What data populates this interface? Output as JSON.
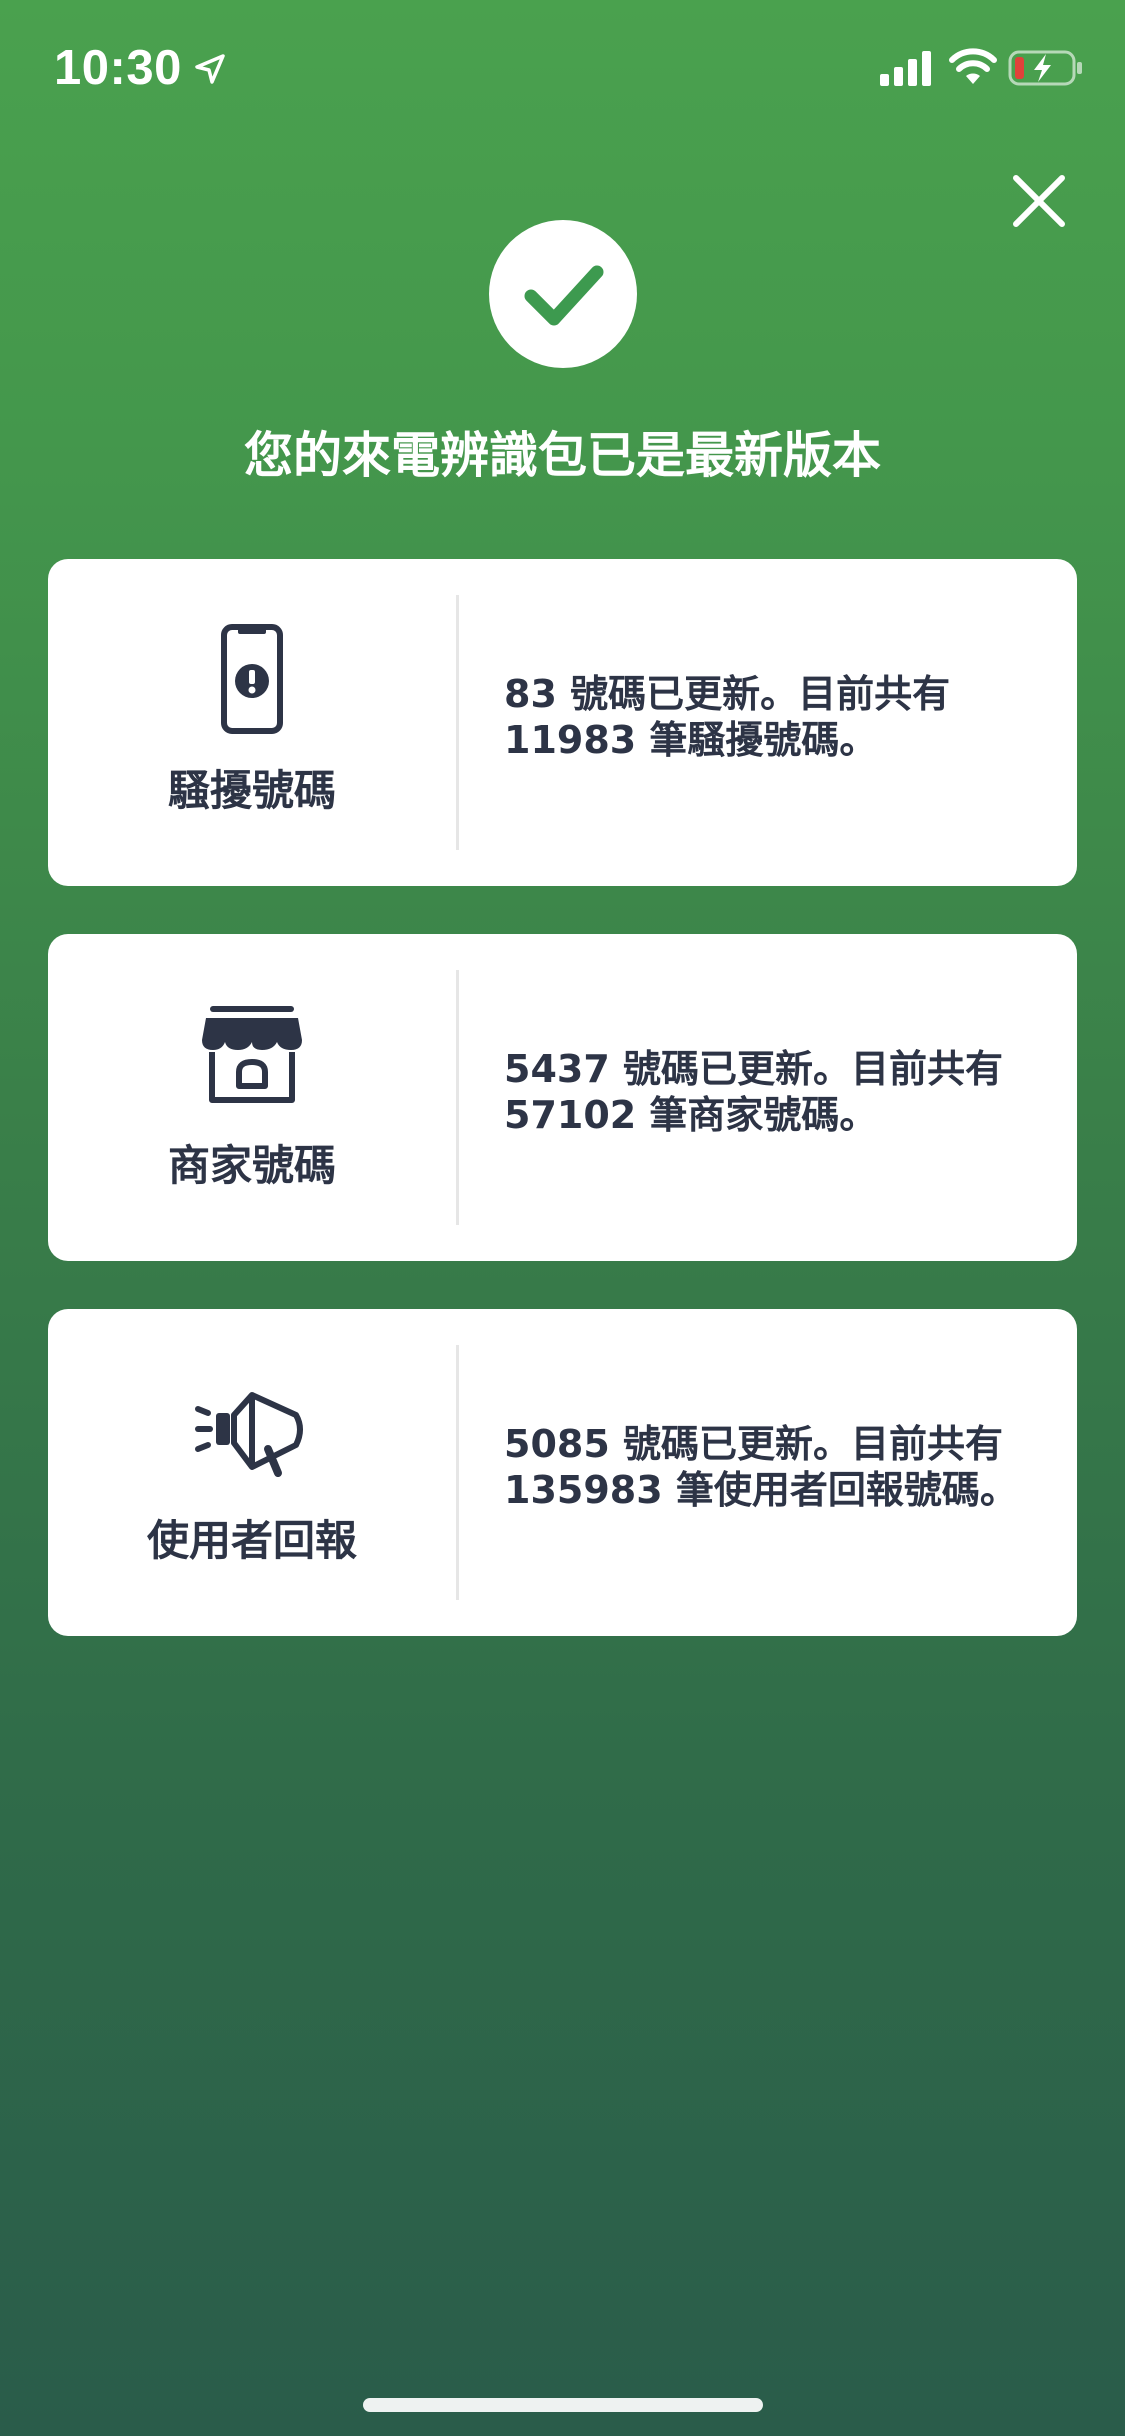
{
  "status_bar": {
    "time": "10:30",
    "location_icon": "location-arrow-icon",
    "signal_icon": "cellular-signal-icon",
    "wifi_icon": "wifi-icon",
    "battery_icon": "battery-charging-icon",
    "battery_color": "#e0413a"
  },
  "header": {
    "close_icon": "close-icon",
    "check_icon": "checkmark-icon",
    "title": "您的來電辨識包已是最新版本"
  },
  "cards": [
    {
      "icon": "phone-alert-icon",
      "label": "騷擾號碼",
      "line1": "83 號碼已更新。目前共有",
      "line2": "11983 筆騷擾號碼。"
    },
    {
      "icon": "storefront-icon",
      "label": "商家號碼",
      "line1": "5437 號碼已更新。目前共有",
      "line2": "57102 筆商家號碼。"
    },
    {
      "icon": "megaphone-icon",
      "label": "使用者回報",
      "line1": "5085 號碼已更新。目前共有",
      "line2": "135983 筆使用者回報號碼。"
    }
  ],
  "colors": {
    "accent_green": "#3d9a4f",
    "text_dark": "#2d3446",
    "background_top": "#4aa14e",
    "background_bottom": "#2a5c4a"
  }
}
